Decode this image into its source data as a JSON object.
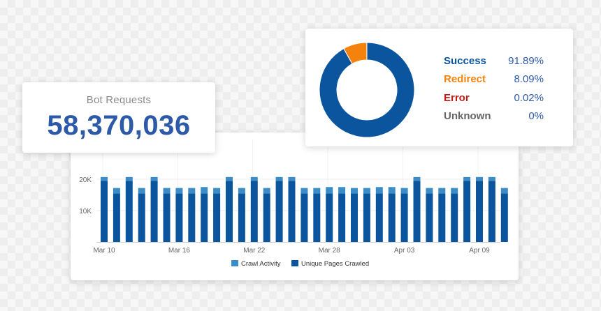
{
  "bot_requests": {
    "label": "Bot Requests",
    "value": "58,370,036"
  },
  "status_breakdown": {
    "items": [
      {
        "name": "Success",
        "value": "91.89%",
        "percent": 91.89,
        "color": "#0b559f"
      },
      {
        "name": "Redirect",
        "value": "8.09%",
        "percent": 8.09,
        "color": "#f5820d"
      },
      {
        "name": "Error",
        "value": "0.02%",
        "percent": 0.02,
        "color": "#c61a1a"
      },
      {
        "name": "Unknown",
        "value": "0%",
        "percent": 0,
        "color": "#666666"
      }
    ]
  },
  "chart_data": {
    "type": "bar",
    "stacked": true,
    "x_tick_labels": [
      "Mar 10",
      "Mar 16",
      "Mar 22",
      "Mar 28",
      "Apr 03",
      "Apr 09"
    ],
    "y_tick_labels": [
      "10K",
      "20K"
    ],
    "ylim": [
      0,
      21000
    ],
    "grid": true,
    "legend_placement": "bottom",
    "series": [
      {
        "name": "Unique Pages Crawled",
        "color": "#0b559f",
        "values": [
          19500,
          15500,
          19500,
          15500,
          19500,
          15500,
          15500,
          15500,
          15500,
          15500,
          19500,
          15500,
          19500,
          15500,
          19500,
          19500,
          15500,
          15500,
          15500,
          15500,
          15500,
          15500,
          15500,
          15500,
          15500,
          19500,
          15500,
          15500,
          15500,
          19500,
          19500,
          19500,
          15500
        ]
      },
      {
        "name": "Crawl Activity",
        "color": "#3b8dc8",
        "values": [
          1200,
          1700,
          1200,
          1700,
          1200,
          1700,
          1700,
          1700,
          2000,
          1700,
          1200,
          1700,
          1200,
          1700,
          1200,
          1200,
          1700,
          1700,
          2000,
          2000,
          1700,
          1700,
          2000,
          2000,
          1700,
          1200,
          1700,
          1700,
          1700,
          1200,
          1200,
          1200,
          1700
        ]
      }
    ],
    "legend": [
      {
        "name": "Crawl Activity",
        "color": "#3b8dc8"
      },
      {
        "name": "Unique Pages Crawled",
        "color": "#0b559f"
      }
    ]
  }
}
